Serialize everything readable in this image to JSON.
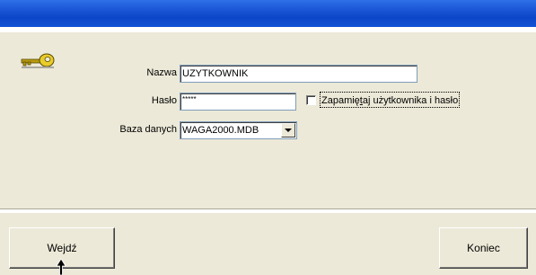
{
  "window": {
    "title": ""
  },
  "form": {
    "name_label": "Nazwa",
    "name_value": "UZYTKOWNIK",
    "password_label": "Hasło",
    "password_value": "*****",
    "remember_label_prefix": "Zapamię",
    "remember_label_accel": "t",
    "remember_label_suffix": "aj użytkownika i hasło",
    "remember_checked": false,
    "database_label": "Baza danych",
    "database_value": "WAGA2000.MDB"
  },
  "buttons": {
    "enter_label": "Wejdź",
    "exit_label": "Koniec"
  },
  "icons": {
    "key": "key-icon",
    "combo_arrow": "chevron-down-icon",
    "cursor": "mouse-pointer-icon"
  },
  "colors": {
    "titlebar": "#0c46c8",
    "panel": "#ece9d8",
    "field_border": "#7f9db9"
  }
}
